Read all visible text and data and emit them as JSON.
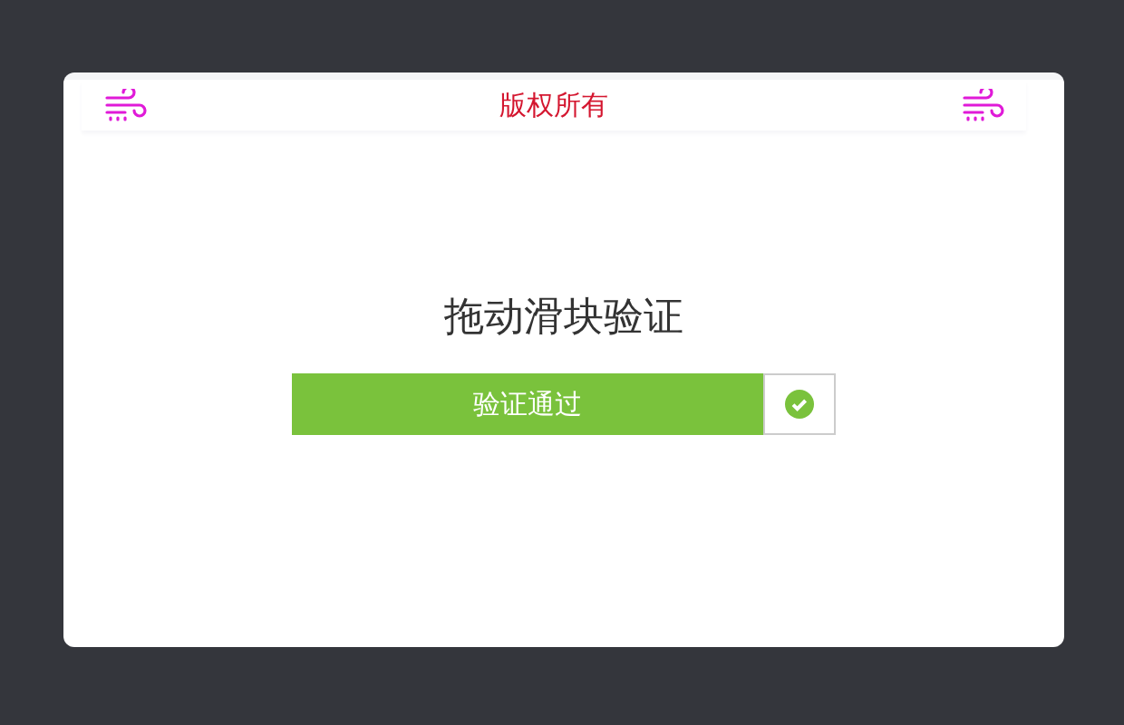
{
  "header": {
    "title": "版权所有"
  },
  "captcha": {
    "title": "拖动滑块验证",
    "status_text": "验证通过",
    "verified": true
  }
}
